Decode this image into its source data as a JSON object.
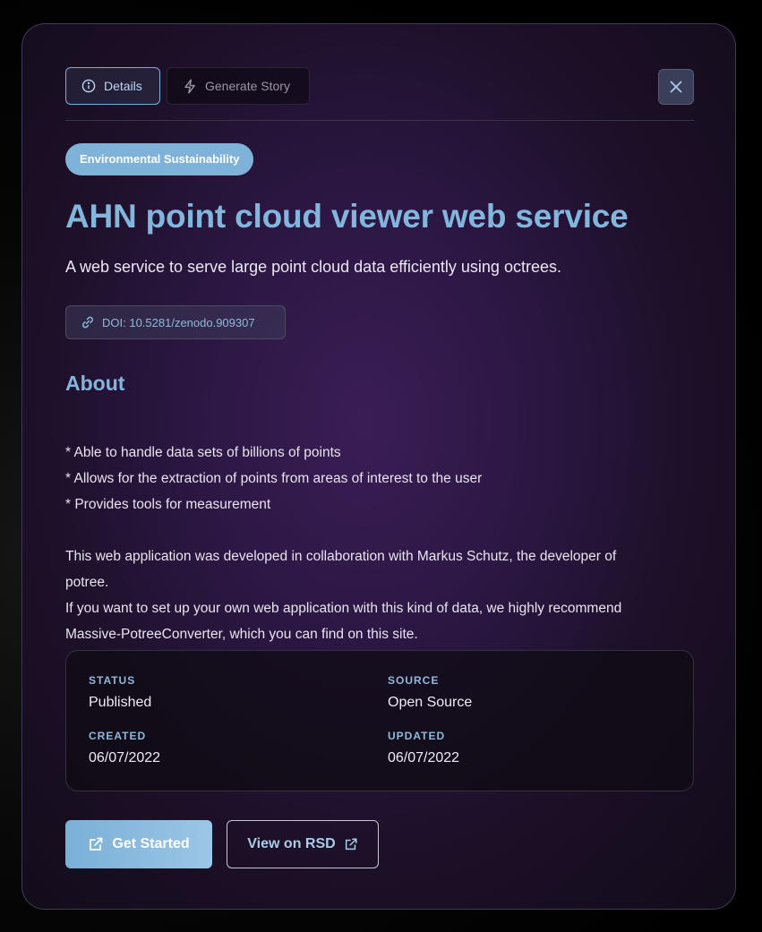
{
  "tabs": [
    {
      "label": "Details",
      "icon": "info-circle-icon",
      "active": true
    },
    {
      "label": "Generate Story",
      "icon": "lightning-icon",
      "active": false
    }
  ],
  "close_icon": "close-icon",
  "badge": "Environmental Sustainability",
  "title": "AHN point cloud viewer web service",
  "subtitle": "A web service to serve large point cloud data efficiently using octrees.",
  "doi": {
    "icon": "link-icon",
    "label": "DOI: 10.5281/zenodo.909307"
  },
  "about": {
    "heading": "About",
    "bullets": [
      "* Able to handle data sets of billions of points",
      "* Allows for the extraction of points from areas of interest to the user",
      "* Provides tools for measurement"
    ],
    "paragraph_lines": [
      "This web application was developed in collaboration with Markus Schutz, the developer of",
      "potree.",
      "If you want to set up your own web application with this kind of data, we highly recommend",
      "Massive-PotreeConverter, which you can find on this site."
    ]
  },
  "meta": {
    "status_label": "STATUS",
    "status_value": "Published",
    "source_label": "SOURCE",
    "source_value": "Open Source",
    "created_label": "CREATED",
    "created_value": "06/07/2022",
    "updated_label": "UPDATED",
    "updated_value": "06/07/2022"
  },
  "actions": {
    "primary_label": "Get Started",
    "primary_icon": "external-link-icon",
    "secondary_label": "View on RSD",
    "secondary_icon": "external-link-icon"
  },
  "colors": {
    "accent": "#82b6dc",
    "badge_bg": "#7fb2d9",
    "modal_bg": "#2c1744"
  }
}
